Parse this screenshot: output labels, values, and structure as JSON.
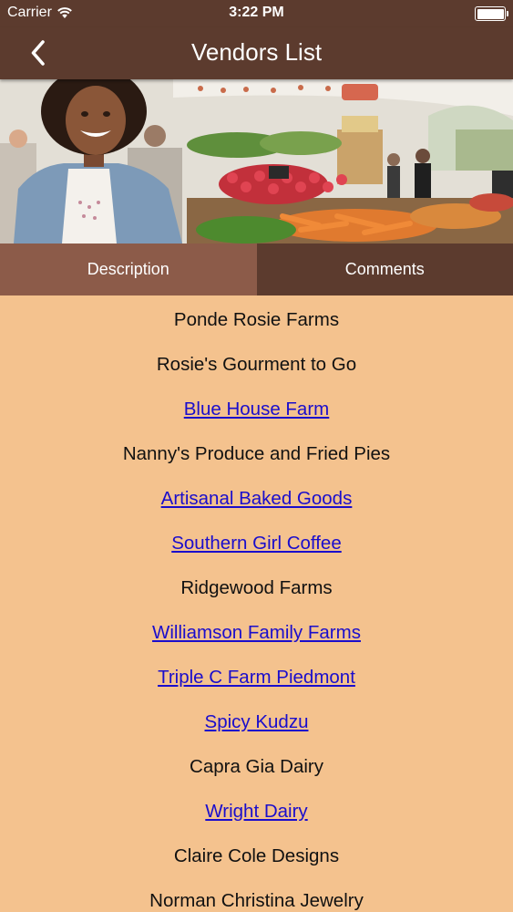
{
  "status": {
    "carrier": "Carrier",
    "time": "3:22 PM"
  },
  "nav": {
    "title": "Vendors List"
  },
  "tabs": [
    {
      "label": "Description",
      "selected": true
    },
    {
      "label": "Comments",
      "selected": false
    }
  ],
  "vendors": [
    {
      "name": "Ponde Rosie Farms",
      "link": false
    },
    {
      "name": "Rosie's Gourment to Go",
      "link": false
    },
    {
      "name": "Blue House Farm",
      "link": true
    },
    {
      "name": "Nanny's Produce and Fried Pies",
      "link": false
    },
    {
      "name": "Artisanal Baked Goods",
      "link": true
    },
    {
      "name": "Southern Girl Coffee",
      "link": true
    },
    {
      "name": "Ridgewood Farms",
      "link": false
    },
    {
      "name": "Williamson Family Farms",
      "link": true
    },
    {
      "name": "Triple C Farm Piedmont",
      "link": true
    },
    {
      "name": "Spicy Kudzu",
      "link": true
    },
    {
      "name": "Capra Gia Dairy",
      "link": false
    },
    {
      "name": "Wright Dairy",
      "link": true
    },
    {
      "name": "Claire Cole Designs",
      "link": false
    },
    {
      "name": "Norman Christina Jewelry",
      "link": false
    }
  ],
  "colors": {
    "bar": "#5c3b2e",
    "tab_selected": "#8c5b49",
    "background": "#f4c28e",
    "link": "#1a0dcc"
  },
  "icons": [
    "wifi-icon",
    "battery-icon",
    "back-chevron-icon"
  ]
}
